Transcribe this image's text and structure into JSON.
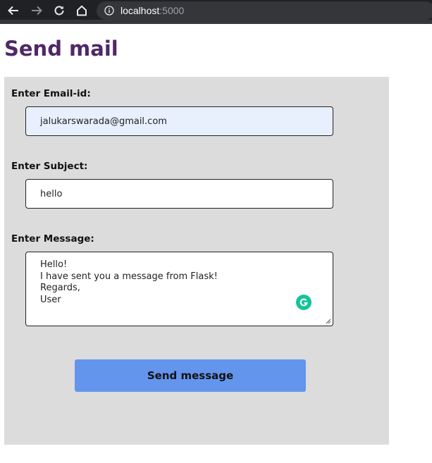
{
  "browser": {
    "url_host": "localhost",
    "url_port": ":5000"
  },
  "page": {
    "title": "Send mail"
  },
  "form": {
    "email_label": "Enter Email-id:",
    "email_value": "jalukarswarada@gmail.com",
    "subject_label": "Enter Subject:",
    "subject_value": "hello",
    "message_label": "Enter Message:",
    "message_lines": [
      "Hello!",
      "I have sent you a message from Flask!",
      "Regards,",
      "User"
    ],
    "submit_label": "Send message"
  },
  "colors": {
    "title": "#4f2866",
    "panel": "#dcdcdc",
    "button": "#6495ed",
    "autofill": "#e8f0fe",
    "grammarly": "#15c39a"
  },
  "icons": [
    "back-arrow-icon",
    "forward-arrow-icon",
    "reload-icon",
    "home-icon",
    "info-icon",
    "grammarly-icon"
  ]
}
